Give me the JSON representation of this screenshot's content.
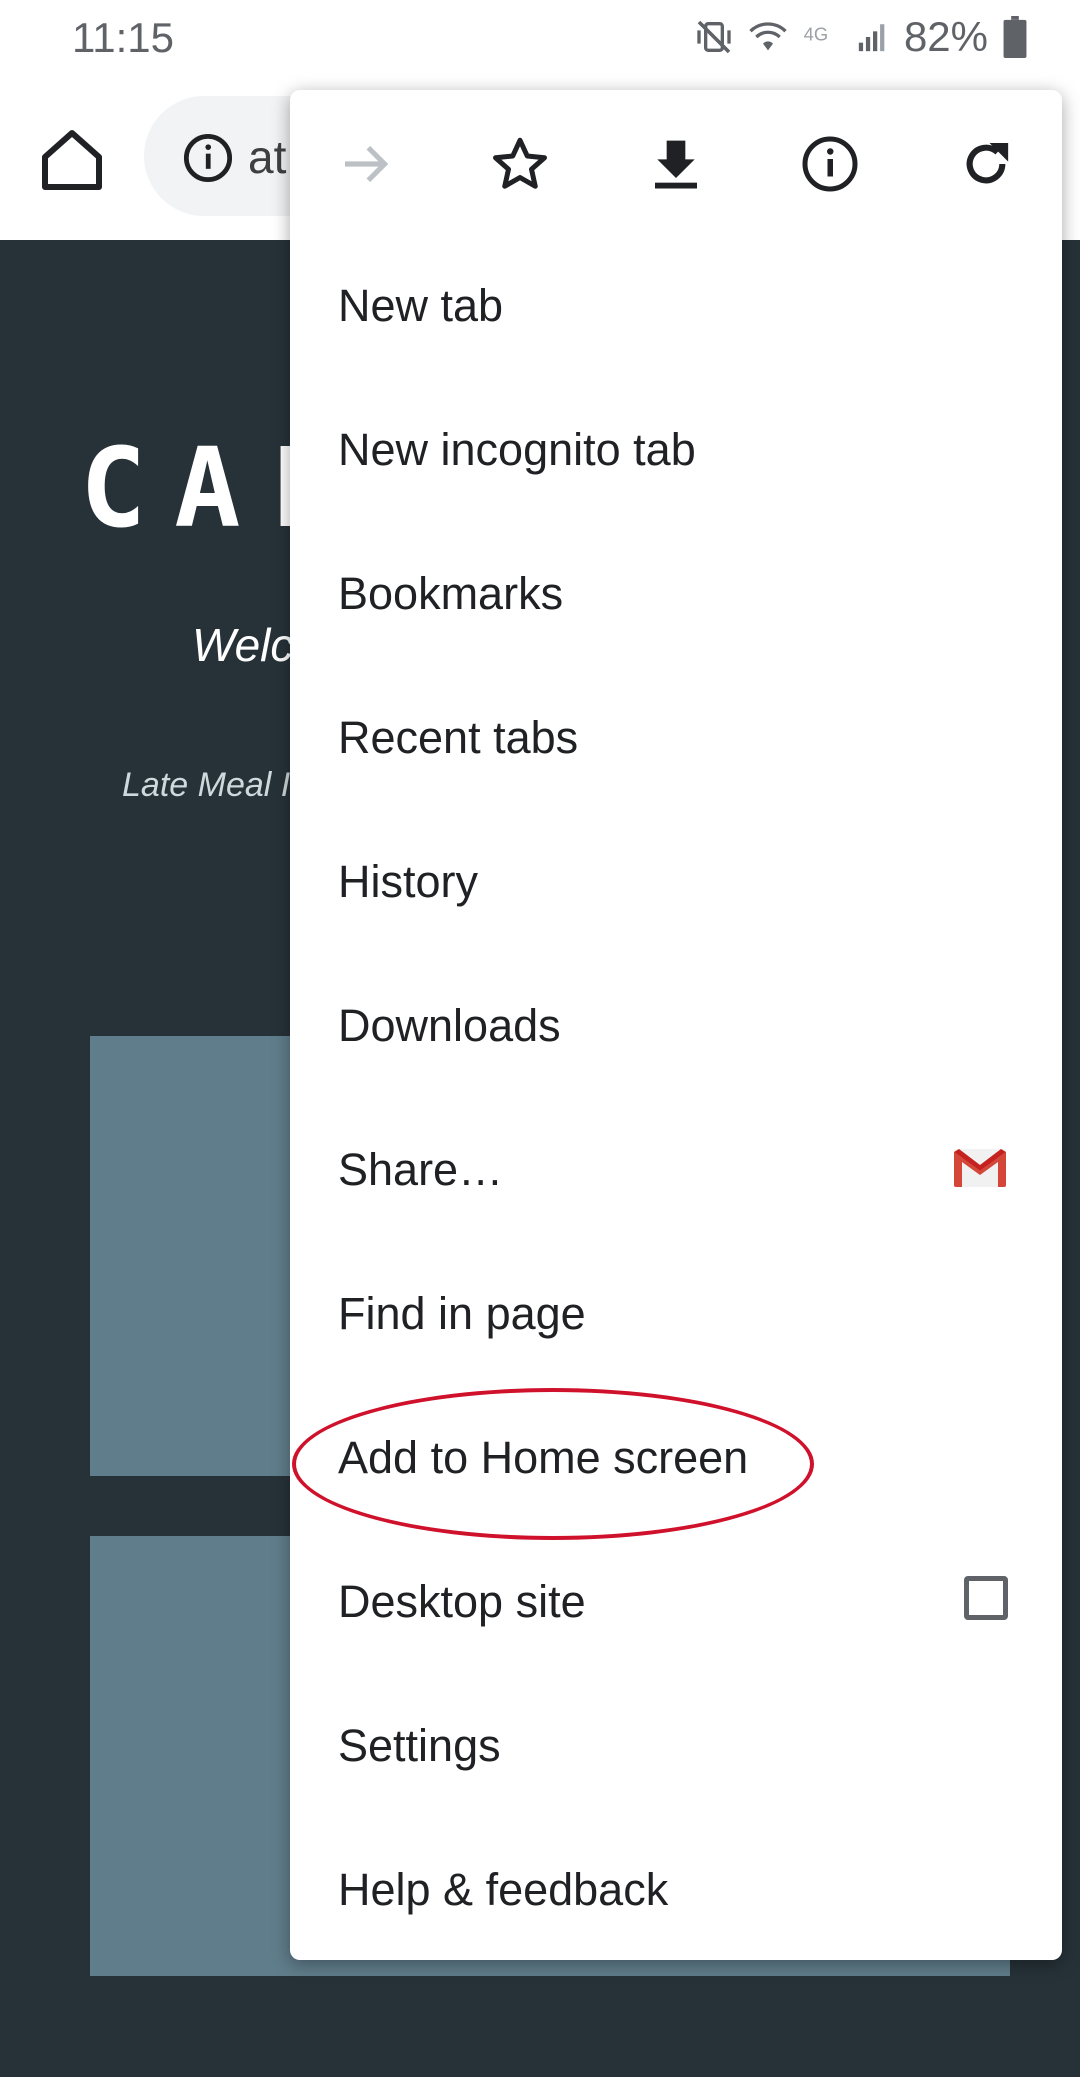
{
  "status_bar": {
    "time": "11:15",
    "battery_percent": "82%",
    "icons": [
      "vibrate-mute-icon",
      "wifi-icon",
      "4g-lte-icon",
      "signal-icon",
      "battery-icon"
    ],
    "network_label": "4G"
  },
  "toolbar": {
    "home_icon": "home-icon",
    "omnibox_icon": "info-icon",
    "url_fragment": "at"
  },
  "page": {
    "site_title": "CAL",
    "welcome": "Welc",
    "late_meal": "Late Meal I"
  },
  "menu": {
    "icon_bar": [
      "forward-icon",
      "star-icon",
      "download-icon",
      "info-icon",
      "refresh-icon"
    ],
    "items": [
      {
        "label": "New tab"
      },
      {
        "label": "New incognito tab"
      },
      {
        "label": "Bookmarks"
      },
      {
        "label": "Recent tabs"
      },
      {
        "label": "History"
      },
      {
        "label": "Downloads"
      },
      {
        "label": "Share…",
        "trailing_icon": "gmail-icon"
      },
      {
        "label": "Find in page"
      },
      {
        "label": "Add to Home screen",
        "highlighted": true
      },
      {
        "label": "Desktop site",
        "trailing": "checkbox",
        "checked": false
      },
      {
        "label": "Settings"
      },
      {
        "label": "Help & feedback"
      }
    ]
  },
  "colors": {
    "page_background": "#263238",
    "card": "#607d8b",
    "highlight": "#d0112b",
    "gmail_red": "#d44638"
  }
}
